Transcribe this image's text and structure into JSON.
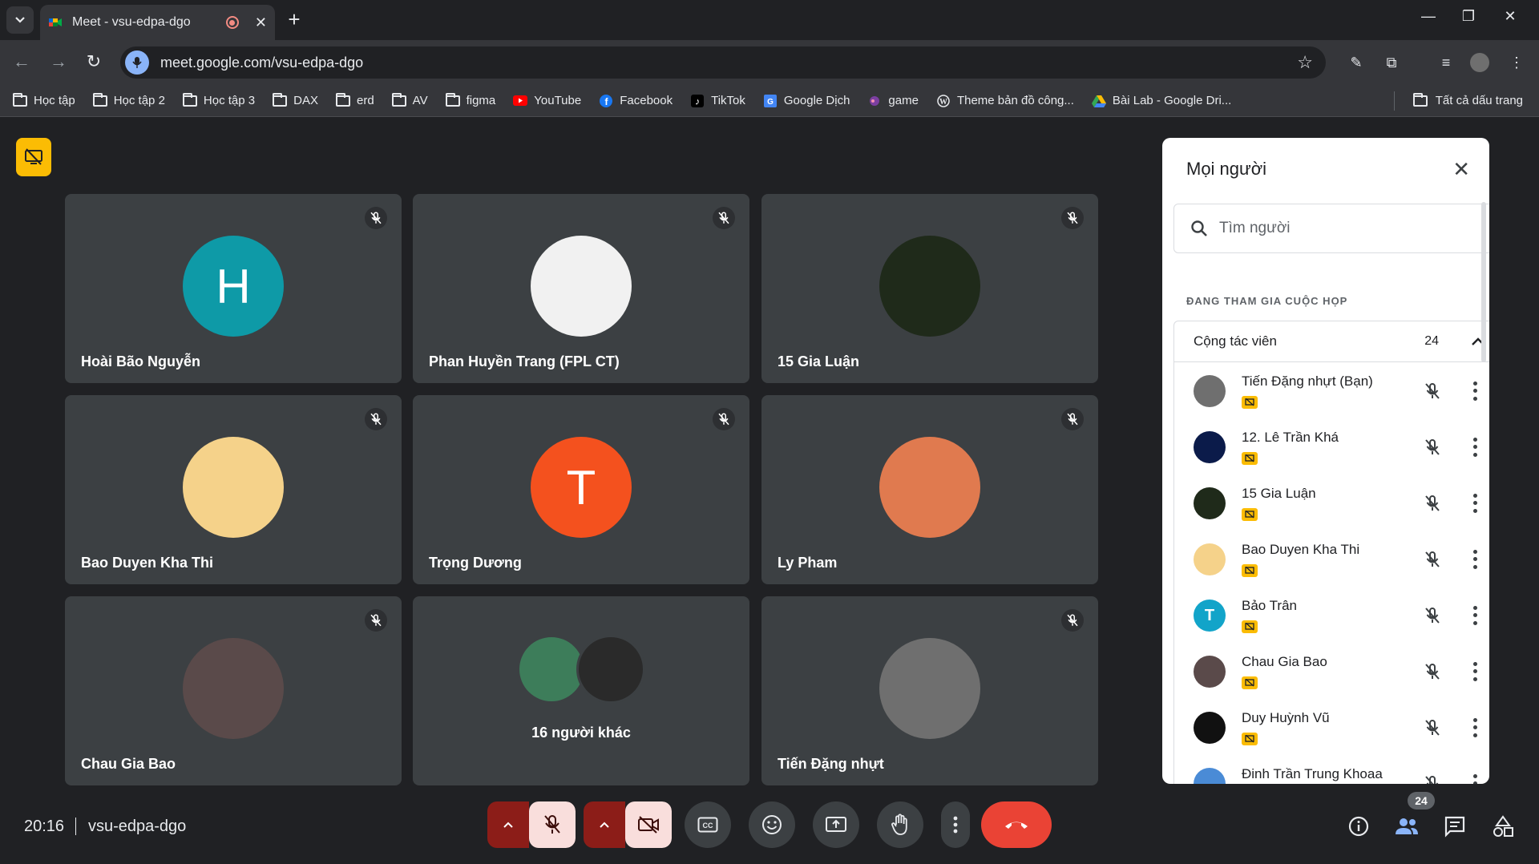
{
  "browser": {
    "tab_title": "Meet - vsu-edpa-dgo",
    "url": "meet.google.com/vsu-edpa-dgo",
    "bookmarks": [
      {
        "label": "Học tập",
        "icon": "folder-icon"
      },
      {
        "label": "Học tập 2",
        "icon": "folder-icon"
      },
      {
        "label": "Học tập 3",
        "icon": "folder-icon"
      },
      {
        "label": "DAX",
        "icon": "folder-icon"
      },
      {
        "label": "erd",
        "icon": "folder-icon"
      },
      {
        "label": "AV",
        "icon": "folder-icon"
      },
      {
        "label": "figma",
        "icon": "folder-icon"
      },
      {
        "label": "YouTube",
        "icon": "youtube-icon"
      },
      {
        "label": "Facebook",
        "icon": "facebook-icon"
      },
      {
        "label": "TikTok",
        "icon": "tiktok-icon"
      },
      {
        "label": "Google Dịch",
        "icon": "google-translate-icon"
      },
      {
        "label": "game",
        "icon": "game-icon"
      },
      {
        "label": "Theme bản đồ công...",
        "icon": "wordpress-icon"
      },
      {
        "label": "Bài Lab - Google Dri...",
        "icon": "google-drive-icon"
      }
    ],
    "all_bookmarks": "Tất cả dấu trang"
  },
  "tiles": [
    {
      "name": "Hoài Bão Nguyễn",
      "initial": "H",
      "color": "#0e9aa7"
    },
    {
      "name": "Phan Huyền Trang (FPL CT)",
      "initial": "",
      "color": "#f1f1f1"
    },
    {
      "name": "15 Gia Luận",
      "initial": "",
      "color": "#1f2a1a"
    },
    {
      "name": "Bao Duyen Kha Thi",
      "initial": "",
      "color": "#f5d28a"
    },
    {
      "name": "Trọng Dương",
      "initial": "T",
      "color": "#f4511e"
    },
    {
      "name": "Ly Pham",
      "initial": "",
      "color": "#e07a4f"
    },
    {
      "name": "Chau Gia Bao",
      "initial": "",
      "color": "#5a4a4a"
    },
    {
      "name": "Tiến Đặng nhựt",
      "initial": "",
      "color": "#6f6f6f"
    }
  ],
  "others_label": "16 người khác",
  "panel": {
    "title": "Mọi người",
    "search_placeholder": "Tìm người",
    "section": "ĐANG THAM GIA CUỘC HỌP",
    "group_name": "Cộng tác viên",
    "group_count": "24",
    "people": [
      {
        "name": "Tiến Đặng nhựt (Bạn)",
        "initial": "",
        "color": "#6f6f6f"
      },
      {
        "name": "12. Lê Trần Khá",
        "initial": "",
        "color": "#0b1b4a"
      },
      {
        "name": "15 Gia Luận",
        "initial": "",
        "color": "#1f2a1a"
      },
      {
        "name": "Bao Duyen Kha Thi",
        "initial": "",
        "color": "#f5d28a"
      },
      {
        "name": "Bảo Trân",
        "initial": "T",
        "color": "#12a4c9"
      },
      {
        "name": "Chau Gia Bao",
        "initial": "",
        "color": "#5a4a4a"
      },
      {
        "name": "Duy Huỳnh Vũ",
        "initial": "",
        "color": "#111111"
      },
      {
        "name": "Đinh Trần Trung Khoaa",
        "initial": "",
        "color": "#4a8bd6"
      }
    ]
  },
  "bottom": {
    "time": "20:16",
    "meeting_code": "vsu-edpa-dgo",
    "people_count": "24"
  }
}
